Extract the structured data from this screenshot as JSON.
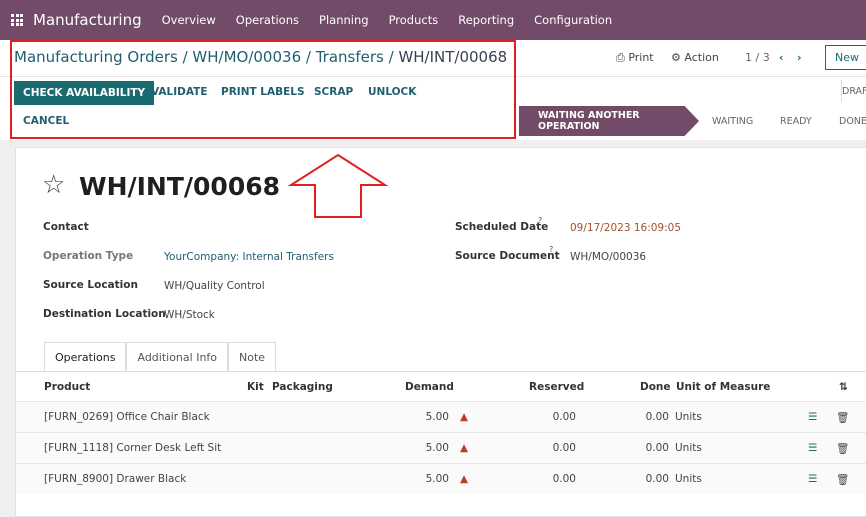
{
  "nav": {
    "app": "Manufacturing",
    "menu": [
      "Overview",
      "Operations",
      "Planning",
      "Products",
      "Reporting",
      "Configuration"
    ]
  },
  "breadcrumb": [
    "Manufacturing Orders",
    "WH/MO/00036",
    "Transfers",
    "WH/INT/00068"
  ],
  "toolbar": {
    "print": "Print",
    "action": "Action",
    "pager": "1 / 3",
    "new": "New"
  },
  "buttons": {
    "check": "CHECK AVAILABILITY",
    "validate": "VALIDATE",
    "print_labels": "PRINT LABELS",
    "scrap": "SCRAP",
    "unlock": "UNLOCK",
    "cancel": "CANCEL"
  },
  "status": {
    "active": "WAITING ANOTHER OPERATION",
    "stages": [
      "WAITING",
      "READY",
      "DONE"
    ],
    "draft": "DRAFT"
  },
  "form": {
    "title": "WH/INT/00068",
    "contact_label": "Contact",
    "optype_label": "Operation Type",
    "optype": "YourCompany: Internal Transfers",
    "src_label": "Source Location",
    "src": "WH/Quality Control",
    "dst_label": "Destination Location",
    "dst": "WH/Stock",
    "sched_label": "Scheduled Date",
    "sched": "09/17/2023 16:09:05",
    "srcdoc_label": "Source Document",
    "srcdoc": "WH/MO/00036"
  },
  "tabs": [
    "Operations",
    "Additional Info",
    "Note"
  ],
  "table": {
    "headers": [
      "Product",
      "Kit",
      "Packaging",
      "Demand",
      "Reserved",
      "Done",
      "Unit of Measure"
    ],
    "rows": [
      {
        "product": "[FURN_0269] Office Chair Black",
        "demand": "5.00",
        "reserved": "0.00",
        "done": "0.00",
        "uom": "Units"
      },
      {
        "product": "[FURN_1118] Corner Desk Left Sit",
        "demand": "5.00",
        "reserved": "0.00",
        "done": "0.00",
        "uom": "Units"
      },
      {
        "product": "[FURN_8900] Drawer Black",
        "demand": "5.00",
        "reserved": "0.00",
        "done": "0.00",
        "uom": "Units"
      }
    ]
  },
  "colors": {
    "brand": "#714B67",
    "accent": "#1a6b70",
    "highlight": "#e02020"
  }
}
